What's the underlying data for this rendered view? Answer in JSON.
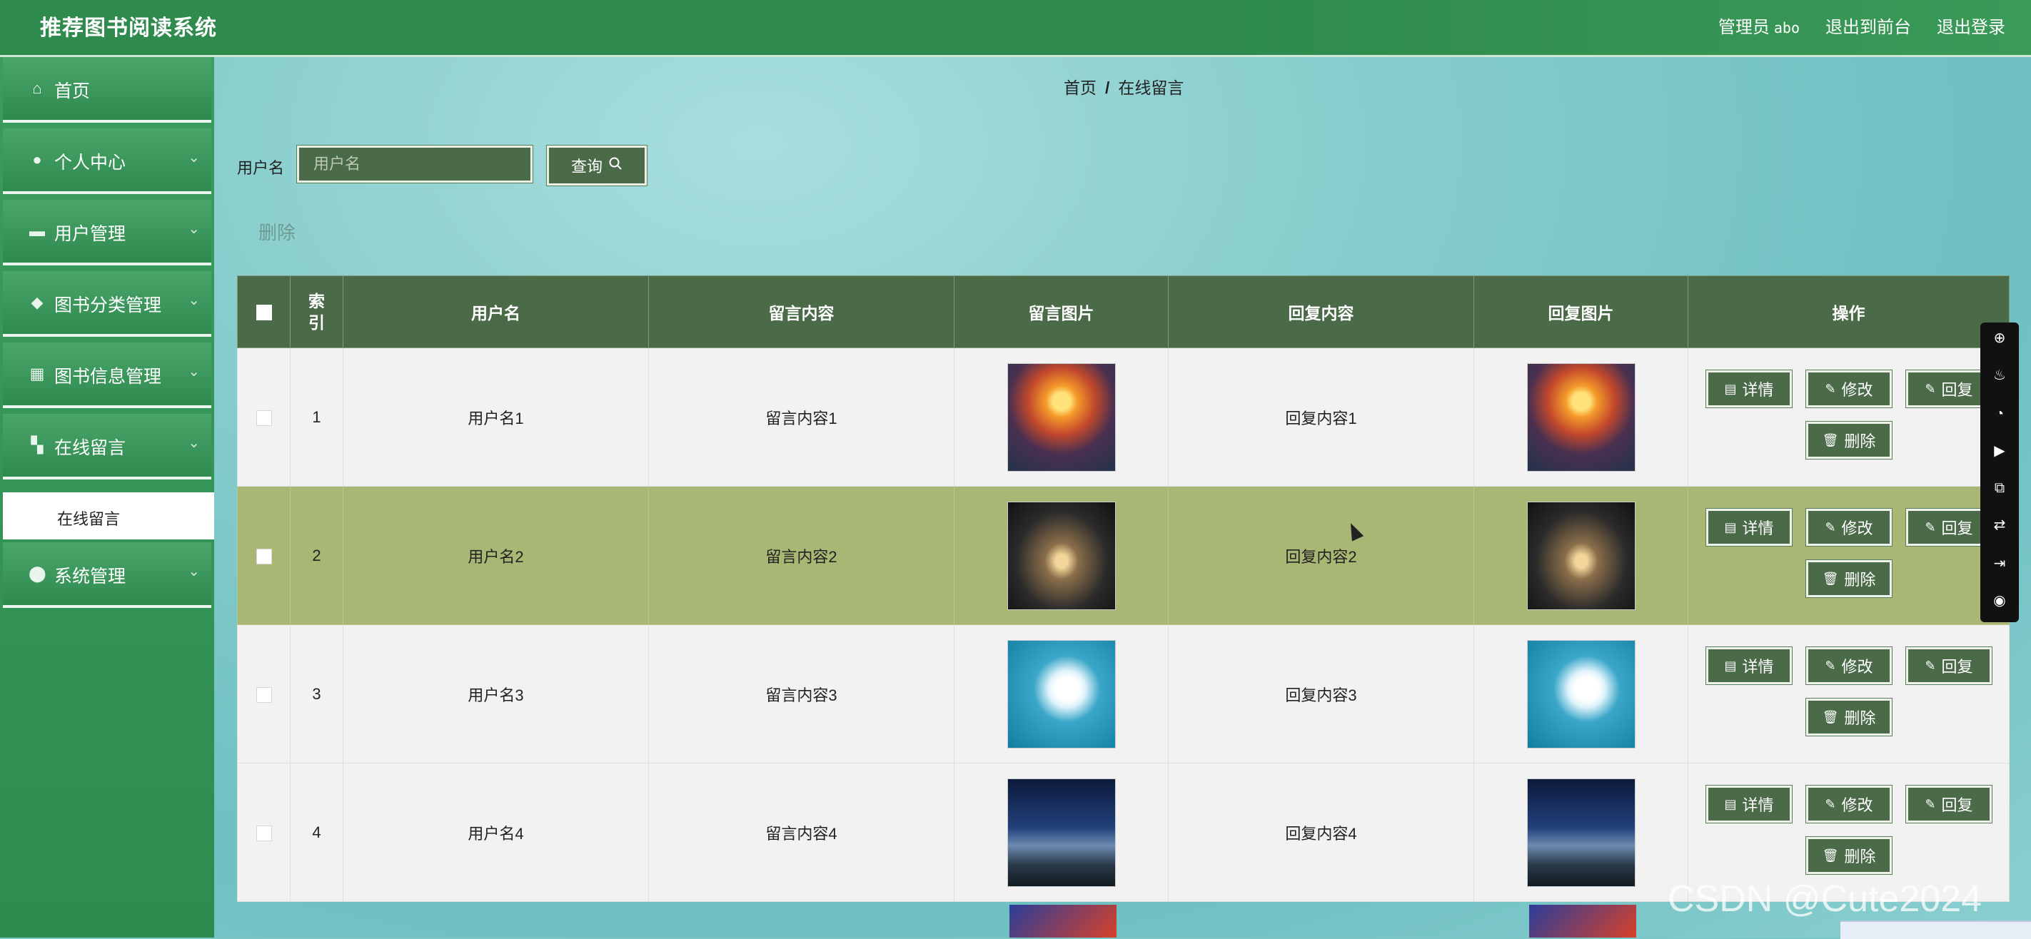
{
  "header": {
    "app_title": "推荐图书阅读系统",
    "admin_role": "管理员",
    "admin_name": "abo",
    "front_link": "退出到前台",
    "logout_link": "退出登录"
  },
  "sidebar": {
    "items": [
      {
        "label": "首页",
        "icon": "home-icon"
      },
      {
        "label": "个人中心",
        "icon": "user-icon"
      },
      {
        "label": "用户管理",
        "icon": "briefcase-icon"
      },
      {
        "label": "图书分类管理",
        "icon": "category-icon"
      },
      {
        "label": "图书信息管理",
        "icon": "grid-icon"
      },
      {
        "label": "在线留言",
        "icon": "apps-icon"
      },
      {
        "label": "系统管理",
        "icon": "location-pin-icon"
      }
    ],
    "submenu": {
      "label": "在线留言"
    }
  },
  "breadcrumb": {
    "home": "首页",
    "sep": "/",
    "current": "在线留言"
  },
  "search": {
    "label": "用户名",
    "placeholder": "用户名",
    "button": "查询"
  },
  "toolbar": {
    "delete_label": "删除"
  },
  "table": {
    "headers": {
      "index": "索\n引",
      "username": "用户名",
      "message": "留言内容",
      "message_image": "留言图片",
      "reply": "回复内容",
      "reply_image": "回复图片",
      "actions": "操作"
    },
    "rows": [
      {
        "index": "1",
        "username": "用户名1",
        "message": "留言内容1",
        "reply": "回复内容1",
        "image": "sunset-harbor"
      },
      {
        "index": "2",
        "username": "用户名2",
        "message": "留言内容2",
        "reply": "回复内容2",
        "image": "tree-lake-dusk"
      },
      {
        "index": "3",
        "username": "用户名3",
        "message": "留言内容3",
        "reply": "回复内容3",
        "image": "white-flower"
      },
      {
        "index": "4",
        "username": "用户名4",
        "message": "留言内容4",
        "reply": "回复内容4",
        "image": "night-valley"
      }
    ],
    "action_labels": {
      "detail": "详情",
      "edit": "修改",
      "reply": "回复",
      "delete": "删除"
    }
  },
  "watermark": "CSDN @Cute2024",
  "colors": {
    "header": "#2f8a4e",
    "table_header": "#4a6a48",
    "selected_row": "#a9b774",
    "button": "#4a6a48"
  }
}
